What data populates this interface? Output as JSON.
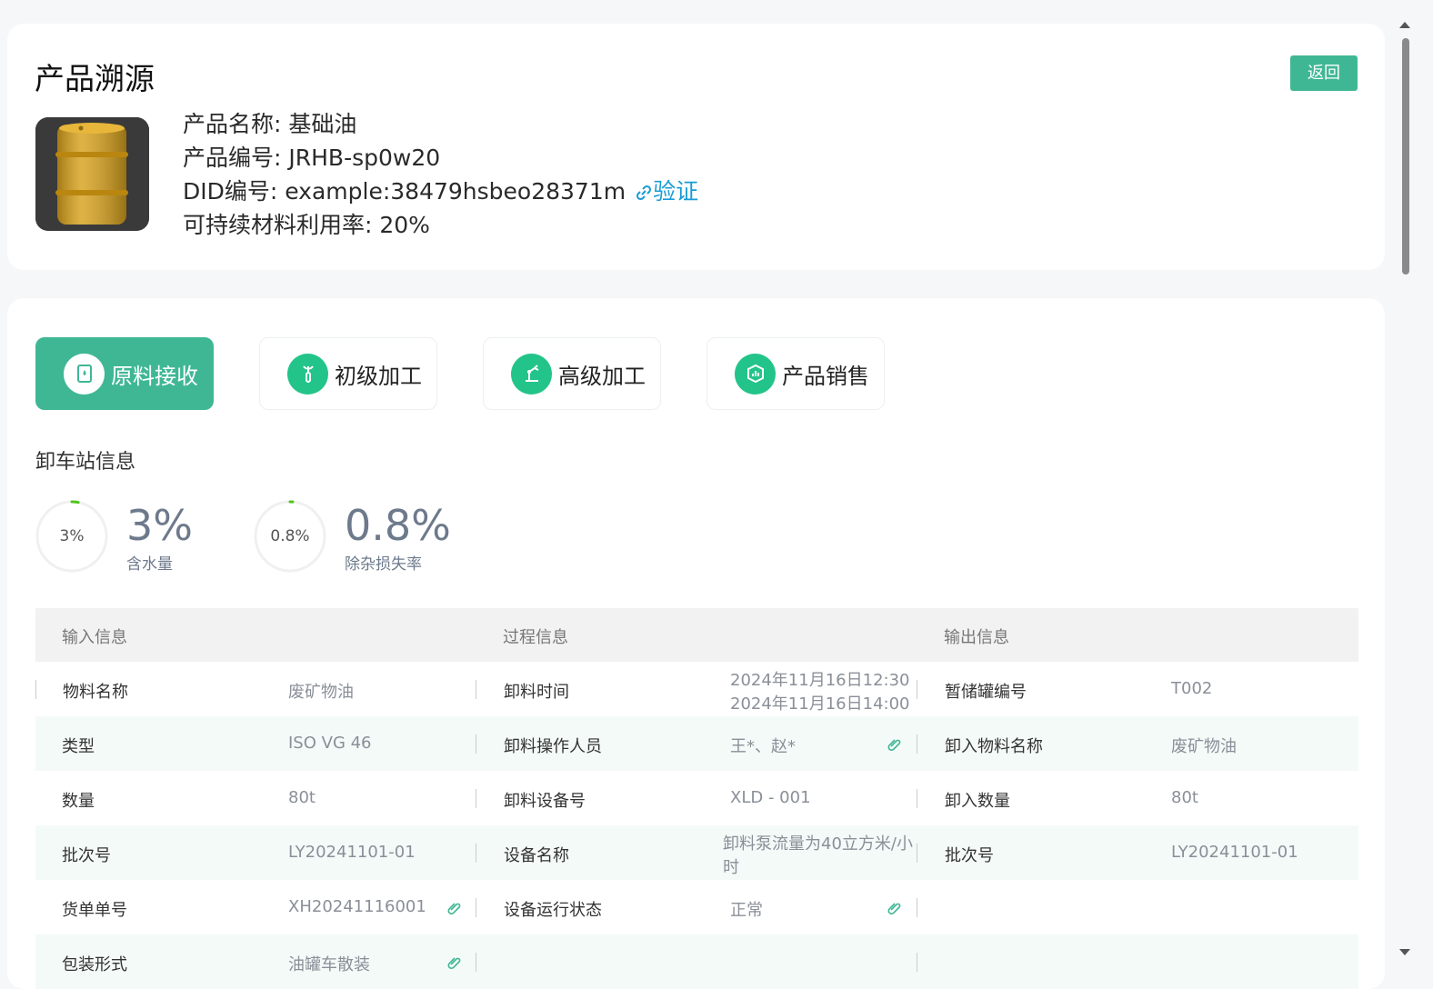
{
  "header": {
    "title": "产品溯源",
    "back_label": "返回"
  },
  "product": {
    "name_line": "产品名称: 基础油",
    "code_line": "产品编号: JRHB-sp0w20",
    "did_line": "DID编号: example:38479hsbeo28371m",
    "verify_label": "验证",
    "rate_line": "可持续材料利用率: 20%"
  },
  "tabs": [
    {
      "label": "原料接收",
      "icon": "barrel-icon",
      "active": true
    },
    {
      "label": "初级加工",
      "icon": "tool-icon",
      "active": false
    },
    {
      "label": "高级加工",
      "icon": "robot-arm-icon",
      "active": false
    },
    {
      "label": "产品销售",
      "icon": "sales-chart-icon",
      "active": false
    }
  ],
  "section": {
    "title": "卸车站信息"
  },
  "stats": [
    {
      "ring_label": "3%",
      "big": "3%",
      "sub": "含水量",
      "fraction": 0.03
    },
    {
      "ring_label": "0.8%",
      "big": "0.8%",
      "sub": "除杂损失率",
      "fraction": 0.008
    }
  ],
  "table": {
    "headers": [
      "输入信息",
      "过程信息",
      "输出信息"
    ],
    "rows": [
      {
        "l1": "物料名称",
        "v1": "废矿物油",
        "l2": "卸料时间",
        "v2a": "2024年11月16日12:30",
        "v2b": "2024年11月16日14:00",
        "l3": "暂储罐编号",
        "v3": "T002"
      },
      {
        "l1": "类型",
        "v1": "ISO VG 46",
        "l2": "卸料操作人员",
        "v2": "王*、赵*",
        "l3": "卸入物料名称",
        "v3": "废矿物油"
      },
      {
        "l1": "数量",
        "v1": "80t",
        "l2": "卸料设备号",
        "v2": "XLD - 001",
        "l3": "卸入数量",
        "v3": "80t"
      },
      {
        "l1": "批次号",
        "v1": "LY20241101-01",
        "l2": "设备名称",
        "v2a": "卸料泵流量为40立方米/小",
        "v2b": "时",
        "l3": "批次号",
        "v3": "LY20241101-01"
      },
      {
        "l1": "货单单号",
        "v1": "XH20241116001",
        "l2": "设备运行状态",
        "v2": "正常"
      },
      {
        "l1": "包装形式",
        "v1": "油罐车散装"
      }
    ]
  },
  "colors": {
    "accent": "#3fb795",
    "icon_green": "#23c48a",
    "link": "#1a9bd6",
    "alt_row": "#f4faf8"
  }
}
